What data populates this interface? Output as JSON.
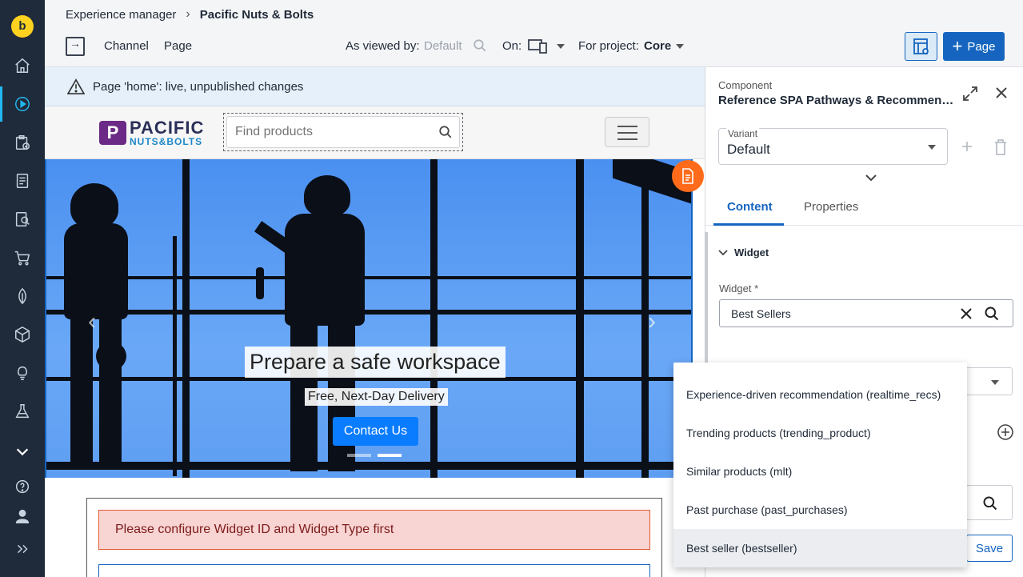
{
  "app": {
    "logo_letter": "b",
    "breadcrumb": {
      "root": "Experience manager",
      "current": "Pacific Nuts & Bolts"
    }
  },
  "toolbar": {
    "channel_label": "Channel",
    "page_label": "Page",
    "viewed_by_label": "As viewed by:",
    "viewed_by_value": "Default",
    "on_label": "On:",
    "project_label": "For project:",
    "project_value": "Core",
    "new_page_label": "Page"
  },
  "nav_icons": [
    "home-icon",
    "experience-manager-icon",
    "projects-icon",
    "content-icon",
    "search-content-icon",
    "commerce-icon",
    "seo-icon",
    "packages-icon",
    "insights-icon",
    "experiments-icon",
    "more-icon",
    "help-icon",
    "user-icon",
    "expand-icon"
  ],
  "status": {
    "message": "Page 'home': live, unpublished changes"
  },
  "site": {
    "logo_mark": "P",
    "logo_word1": "PACIFIC",
    "logo_word2": "NUTS&BOLTS",
    "search_placeholder": "Find products",
    "hero_title": "Prepare a safe workspace",
    "hero_subtitle": "Free, Next-Day Delivery",
    "hero_cta": "Contact Us",
    "config_alert": "Please configure Widget ID and Widget Type first"
  },
  "panel": {
    "component_label": "Component",
    "component_title": "Reference SPA Pathways & Recommendations",
    "variant_label": "Variant",
    "variant_value": "Default",
    "tabs": [
      {
        "label": "Content"
      },
      {
        "label": "Properties"
      }
    ],
    "section_title": "Widget",
    "widget_label": "Widget *",
    "widget_value": "Best Sellers",
    "save_label": "Save"
  },
  "dropdown": {
    "items": [
      {
        "label": "Experience-driven recommendation (realtime_recs)"
      },
      {
        "label": "Trending products (trending_product)"
      },
      {
        "label": "Similar products (mlt)"
      },
      {
        "label": "Past purchase (past_purchases)"
      },
      {
        "label": "Best seller (bestseller)"
      }
    ],
    "hovered_index": 4
  },
  "colors": {
    "nav_bg": "#1f2a3a",
    "accent": "#1565c0",
    "logo_yellow": "#ffd21f",
    "status_bg": "#e5f0fa",
    "alert_bg": "#f8d4d3",
    "alert_border": "#e05b32",
    "cta_blue": "#0a7cff",
    "badge_orange": "#ff6b1a"
  }
}
